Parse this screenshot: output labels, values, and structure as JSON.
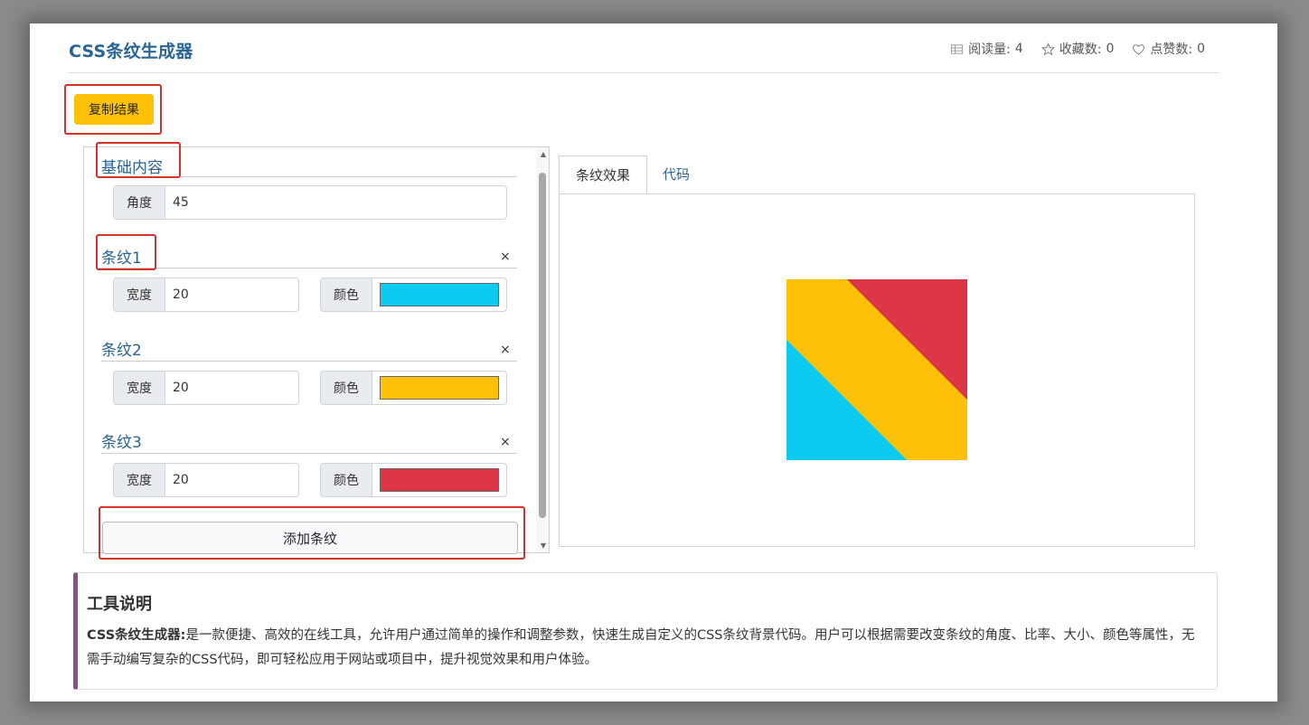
{
  "header": {
    "title": "CSS条纹生成器",
    "read_label": "阅读量:",
    "read_count": "4",
    "fav_label": "收藏数:",
    "fav_count": "0",
    "like_label": "点赞数:",
    "like_count": "0"
  },
  "toolbar": {
    "copy_label": "复制结果"
  },
  "base": {
    "title": "基础内容",
    "angle_label": "角度",
    "angle_value": "45"
  },
  "stripes": [
    {
      "title": "条纹1",
      "width_label": "宽度",
      "width_value": "20",
      "color_label": "颜色",
      "color": "#0dcaf0"
    },
    {
      "title": "条纹2",
      "width_label": "宽度",
      "width_value": "20",
      "color_label": "颜色",
      "color": "#ffc107"
    },
    {
      "title": "条纹3",
      "width_label": "宽度",
      "width_value": "20",
      "color_label": "颜色",
      "color": "#dc3545"
    }
  ],
  "close_glyph": "×",
  "add_label": "添加条纹",
  "tabs": {
    "effect": "条纹效果",
    "code": "代码"
  },
  "info": {
    "heading": "工具说明",
    "lead": "CSS条纹生成器:",
    "body": "是一款便捷、高效的在线工具，允许用户通过简单的操作和调整参数，快速生成自定义的CSS条纹背景代码。用户可以根据需要改变条纹的角度、比率、大小、颜色等属性，无需手动编写复杂的CSS代码，即可轻松应用于网站或项目中，提升视觉效果和用户体验。"
  },
  "icons": {
    "read": "table-icon",
    "fav": "star-icon",
    "like": "heart-icon"
  },
  "colors": {
    "accent": "#2a6496",
    "button": "#ffc107",
    "highlight": "#d9302a",
    "info_border": "#8e4c8a"
  }
}
